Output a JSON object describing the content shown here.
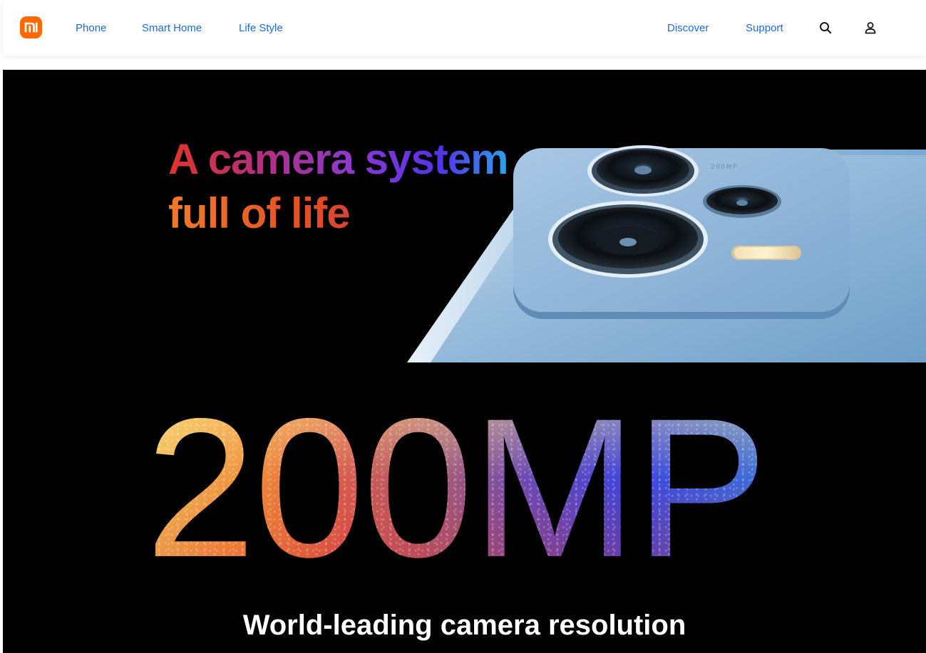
{
  "brand": {
    "logo_text": "mi",
    "logo_color": "#ff6900"
  },
  "nav": {
    "left": [
      {
        "label": "Phone"
      },
      {
        "label": "Smart Home"
      },
      {
        "label": "Life Style"
      }
    ],
    "right": [
      {
        "label": "Discover"
      },
      {
        "label": "Support"
      }
    ],
    "link_color": "#1e6bd6",
    "icons": [
      "search-icon",
      "user-icon"
    ]
  },
  "hero": {
    "headline_line1": "A camera system",
    "headline_line2": "full of life",
    "big_number": "200MP",
    "phone_badge": "200MP",
    "subtitle": "World-leading camera resolution",
    "background": "#000000"
  }
}
